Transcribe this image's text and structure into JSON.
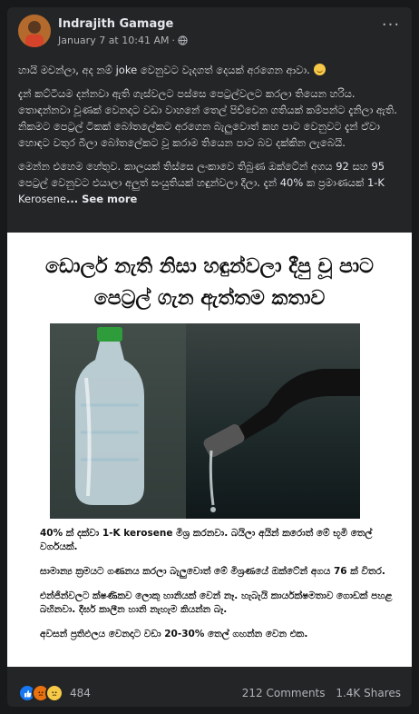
{
  "post": {
    "author": "Indrajith Gamage",
    "timestamp": "January 7 at 10:41 AM",
    "separator": "·",
    "audience_icon": "globe-icon",
    "more_label": "···",
    "text": {
      "p1": "හායි මචන්ලා, අද නම් joke වෙනුවට වැදගත් දෙයක් අරගෙන ආවා.",
      "p2": "දැන් කට්ටියම දන්නවා ඇති ගැස්වලට පස්සෙ පෙට්‍රල්වලට කරලා තියෙන හරිය. තොඳන්නවා චූණක් වෙනදාට වඩා වාහනේ තෙල් පිච්චෙන ගතියක් කම්පන්ට දැනිලා ඇති. නිකමට පෙට්‍රල් ටිකක් බෝතලේකට අරගෙන බැලුවොත් කහ පාට වෙනුවට දැන් ඒවා හොඳට වතුර බීලා බෝතලේකට වූ කරාම තියෙන පාට බව දක්කින ලැබෙයි.",
      "p3_lead": "මෙන්න එහෙම හේතුව. කාලයක් තිස්සෙ ලංකාවෙ තිබුණ ඔක්ටේන් අගය 92 සහ 95 පෙට්‍රල් වෙනුවට එයාලා අලුත් සංයුතියක් හඳුන්වලා දීලා. දැන් 40% ක ප්‍රමාණයක් 1-K Kerosene",
      "see_more": "... See more"
    }
  },
  "image": {
    "title": "ඩොලර් නැති නිසා හඳුන්වලා දීපු චූ පාට පෙට්‍රල් ගැන ඇත්තම කතාව",
    "body": [
      "40% ක් දක්වා 1-K kerosene මිශ්‍ර කරනවා. බයිලා අයින් කරොත් මේ භූමි තෙල් වර්ගයක්.",
      "සාමාන්‍ය ක්‍රමයට ගණනය කරලා බැලුවොත් මේ මිශ්‍රණයේ ඔක්ටේන් අගය 76 ක් විතර.",
      "එන්ජින්වලට ක්ෂණිකව ලොකු හානියක් වෙන් නෑ. හැබැයි කාර්යක්ෂමතාව ගොඩක් පහළ බහිනවා. දීර්ඝ කාලීන හානි නැහැම කියන්න බෑ.",
      "අවසන් ප්‍රතිඵලය වෙනදාට වඩා 20-30% තෙල් ගහන්න වෙන එක."
    ]
  },
  "footer": {
    "reaction_icons": [
      "like-icon",
      "angry-icon",
      "sad-icon"
    ],
    "reaction_count": "484",
    "comments": "212 Comments",
    "shares": "1.4K Shares"
  },
  "colors": {
    "background": "#18191a",
    "card": "#242526",
    "text_primary": "#e4e6eb",
    "text_secondary": "#b0b3b8",
    "like": "#1877f2"
  }
}
